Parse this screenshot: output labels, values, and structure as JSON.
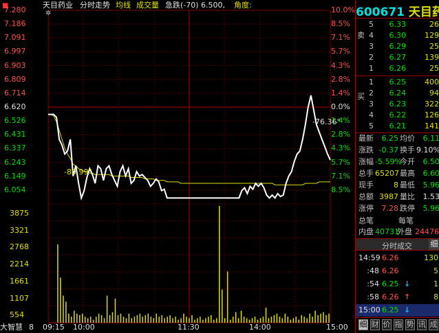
{
  "header": {
    "stock_name": "天目药业",
    "chart_type": "分时走势",
    "avg_label": "均线",
    "vol_label": "成交量",
    "alert_text": "急跌(-70) 6.500,",
    "angle_label": "角度:"
  },
  "price_axis": [
    "7.280",
    "7.186",
    "7.091",
    "6.997",
    "6.903",
    "6.809",
    "6.714",
    "6.620",
    "6.526",
    "6.431",
    "6.337",
    "6.243",
    "6.149",
    "6.054"
  ],
  "pct_axis": [
    "10.0%",
    "8.5%",
    "7.1%",
    "5.7%",
    "4.3%",
    "2.8%",
    "1.4%",
    "0.0%",
    "1.4%",
    "2.8%",
    "4.3%",
    "5.7%",
    "7.1%",
    "8.5%"
  ],
  "vol_axis": [
    "3875",
    "3321",
    "2768",
    "2214",
    "1661",
    "1107",
    "554"
  ],
  "time_axis": [
    "8",
    "09:15",
    "10:00",
    "11:30",
    "14:00",
    "15:00"
  ],
  "brand": "大智慧",
  "annotations": {
    "angle1": "-80.99°",
    "angle2": "-76.36°"
  },
  "chart_data": {
    "type": "line",
    "prev_close": 6.62,
    "ylim": [
      6.054,
      7.28
    ],
    "price_points_y": [
      6.57,
      6.57,
      6.57,
      6.55,
      6.4,
      6.36,
      6.3,
      6.32,
      6.4,
      6.15,
      6.22,
      6.1,
      6.0,
      6.05,
      6.14,
      6.2,
      6.16,
      6.1,
      6.22,
      6.2,
      6.12,
      6.2,
      6.22,
      6.16,
      6.12,
      6.08,
      6.18,
      6.22,
      6.15,
      6.2,
      6.1,
      6.12,
      6.18,
      6.15,
      6.16,
      6.14,
      6.12,
      6.08,
      6.1,
      6.13,
      6.11,
      6.05,
      6.06,
      6.0,
      6.0,
      6.0,
      6.0,
      6.0,
      6.0,
      6.0,
      6.0,
      6.0,
      6.0,
      6.0,
      6.0,
      6.0,
      6.0,
      6.0,
      6.0,
      6.0,
      6.0,
      6.0,
      6.0,
      6.0,
      6.0,
      6.0,
      6.0,
      6.0,
      6.0,
      6.0,
      6.05,
      6.07,
      6.03,
      6.08,
      6.06,
      6.1,
      6.08,
      6.1,
      6.07,
      6.02,
      6.0,
      6.02,
      6.0,
      6.03,
      6.01,
      6.02,
      6.1,
      6.15,
      6.18,
      6.25,
      6.3,
      6.32,
      6.4,
      6.5,
      6.62,
      6.7,
      6.6,
      6.5,
      6.45,
      6.4,
      6.35,
      6.3,
      6.26
    ],
    "avg_points_y": [
      6.57,
      6.57,
      6.56,
      6.52,
      6.46,
      6.4,
      6.34,
      6.3,
      6.27,
      6.23,
      6.22,
      6.2,
      6.19,
      6.18,
      6.18,
      6.17,
      6.17,
      6.16,
      6.16,
      6.16,
      6.16,
      6.16,
      6.16,
      6.15,
      6.15,
      6.15,
      6.15,
      6.15,
      6.15,
      6.15,
      6.14,
      6.14,
      6.14,
      6.14,
      6.14,
      6.13,
      6.13,
      6.13,
      6.13,
      6.12,
      6.12,
      6.12,
      6.12,
      6.11,
      6.11,
      6.11,
      6.11,
      6.11,
      6.1,
      6.1,
      6.1,
      6.1,
      6.1,
      6.1,
      6.1,
      6.1,
      6.1,
      6.1,
      6.1,
      6.1,
      6.1,
      6.1,
      6.1,
      6.1,
      6.1,
      6.1,
      6.1,
      6.1,
      6.1,
      6.1,
      6.1,
      6.1,
      6.1,
      6.1,
      6.1,
      6.1,
      6.1,
      6.1,
      6.1,
      6.1,
      6.1,
      6.1,
      6.09,
      6.09,
      6.09,
      6.09,
      6.09,
      6.09,
      6.09,
      6.09,
      6.09,
      6.09,
      6.09,
      6.1,
      6.1,
      6.1,
      6.1,
      6.1,
      6.11,
      6.11,
      6.11,
      6.11,
      6.11
    ],
    "volume": [
      0,
      0,
      0,
      2600,
      1500,
      900,
      700,
      300,
      200,
      400,
      300,
      250,
      300,
      200,
      150,
      200,
      100,
      200,
      300,
      250,
      150,
      900,
      250,
      350,
      800,
      250,
      300,
      200,
      150,
      300,
      150,
      200,
      250,
      300,
      200,
      250,
      300,
      200,
      150,
      300,
      200,
      250,
      150,
      200,
      250,
      150,
      200,
      100,
      150,
      300,
      200,
      150,
      250,
      100,
      150,
      200,
      100,
      150,
      200,
      250,
      100,
      150,
      3875,
      1100,
      150,
      1700,
      100,
      200,
      350,
      150,
      400,
      200,
      150,
      100,
      150,
      200,
      100,
      150,
      200,
      500,
      150,
      200,
      250,
      300,
      200,
      150,
      300,
      200,
      100,
      150,
      200,
      100,
      250,
      200,
      150,
      300,
      200,
      400,
      250,
      300,
      350,
      250,
      300
    ],
    "vol_max": 3875
  },
  "panel": {
    "code": "600671",
    "name": "天目药",
    "sell_side": "卖",
    "buy_side": "买",
    "asks": [
      {
        "lv": "5",
        "price": "6.33",
        "vol": "26"
      },
      {
        "lv": "4",
        "price": "6.30",
        "vol": "129"
      },
      {
        "lv": "3",
        "price": "6.29",
        "vol": "25"
      },
      {
        "lv": "2",
        "price": "6.27",
        "vol": "139"
      },
      {
        "lv": "1",
        "price": "6.26",
        "vol": "25"
      }
    ],
    "bids": [
      {
        "lv": "1",
        "price": "6.25",
        "vol": "400"
      },
      {
        "lv": "2",
        "price": "6.24",
        "vol": "94"
      },
      {
        "lv": "3",
        "price": "6.23",
        "vol": "322"
      },
      {
        "lv": "4",
        "price": "6.22",
        "vol": "126"
      },
      {
        "lv": "5",
        "price": "6.21",
        "vol": "141"
      }
    ],
    "quote": [
      {
        "l1": "最新",
        "v1": "6.25",
        "l2": "均价",
        "v2": "6.11"
      },
      {
        "l1": "涨跌",
        "v1": "-0.37",
        "l2": "换手",
        "v2": "9.10%"
      },
      {
        "l1": "涨幅",
        "v1": "-5.59%",
        "l2": "今开",
        "v2": "6.50"
      },
      {
        "l1": "总手",
        "v1": "65207",
        "l2": "最高",
        "v2": "6.60"
      },
      {
        "l1": "现手",
        "v1": "8",
        "l2": "最低",
        "v2": "5.96"
      },
      {
        "l1": "总额",
        "v1": "3987",
        "l2": "量比",
        "v2": "1.53"
      },
      {
        "l1": "涨停",
        "v1": "7.28",
        "l2": "跌停",
        "v2": "5.96"
      }
    ],
    "order_label": "总笔",
    "per_label": "每笔",
    "inner_label": "内盘",
    "inner_val": "40731",
    "outer_label": "外盘",
    "outer_val": "24476",
    "trades_title": "分时成交",
    "trades_btn": "细",
    "trades": [
      {
        "t": "14:59",
        "p": "6.26",
        "v": "130",
        "dir": ""
      },
      {
        "t": ":48",
        "p": "6.26",
        "v": "5",
        "dir": ""
      },
      {
        "t": ":54",
        "p": "6.25",
        "v": "1",
        "dir": "down"
      },
      {
        "t": ":58",
        "p": "6.26",
        "v": "8",
        "dir": "up"
      },
      {
        "t": "15:00",
        "p": "6.25",
        "v": "",
        "dir": "down"
      }
    ],
    "tabs": [
      "细",
      "财",
      "价",
      "指",
      "势",
      "讯",
      "成"
    ]
  }
}
